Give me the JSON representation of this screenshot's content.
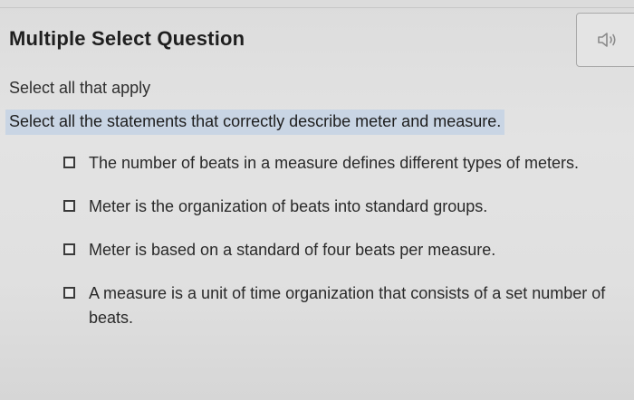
{
  "question": {
    "heading": "Multiple Select Question",
    "audio_icon": "speaker-icon",
    "instruction": "Select all that apply",
    "prompt": "Select all the statements that correctly describe meter and measure.",
    "highlight_color": "#c9d5e4"
  },
  "options": [
    {
      "text": "The number of beats in a measure defines different types of meters.",
      "checked": false
    },
    {
      "text": "Meter is the organization of beats into standard groups.",
      "checked": false
    },
    {
      "text": "Meter is based on a standard of four beats per measure.",
      "checked": false
    },
    {
      "text": "A measure is a unit of time organization that consists of a set number of beats.",
      "checked": false
    }
  ]
}
